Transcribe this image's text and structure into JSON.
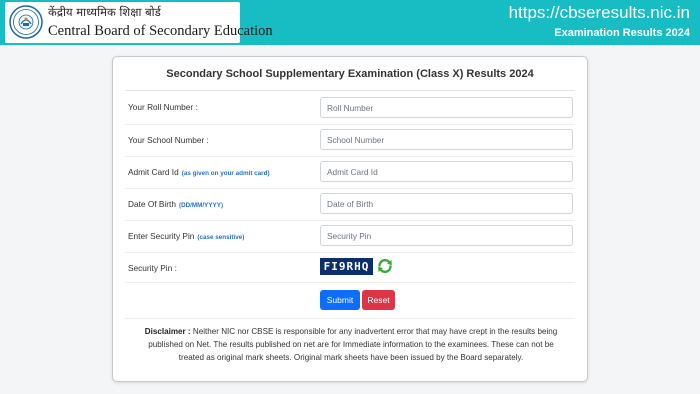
{
  "header": {
    "board_name_hindi": "केंद्रीय माध्यमिक शिक्षा बोर्ड",
    "board_name_english": "Central Board of Secondary Education",
    "site_url": "https://cbseresults.nic.in",
    "site_subtitle": "Examination Results 2024",
    "accent_color": "#18bcc3"
  },
  "form": {
    "title": "Secondary School Supplementary Examination (Class X) Results 2024",
    "roll_number": {
      "label": "Your Roll Number :",
      "placeholder": "Roll Number",
      "value": ""
    },
    "school_number": {
      "label": "Your School Number :",
      "placeholder": "School Number",
      "value": ""
    },
    "admit_card": {
      "label": "Admit Card Id",
      "hint": "(as given on your admit card)",
      "placeholder": "Admit Card Id",
      "value": ""
    },
    "dob": {
      "label": "Date Of Birth",
      "hint": "(DD/MM/YYYY)",
      "placeholder": "Date of Birth",
      "value": ""
    },
    "security_pin_entry": {
      "label": "Enter Security Pin",
      "hint": "(case sensitive)",
      "placeholder": "Security Pin",
      "value": ""
    },
    "security_pin": {
      "label": "Security Pin :",
      "captcha_text": "FI9RHQ",
      "refresh_icon": "refresh-icon"
    },
    "submit_label": "Submit",
    "reset_label": "Reset"
  },
  "disclaimer": {
    "label": "Disclaimer :",
    "text": "Neither NIC nor CBSE is responsible for any inadvertent error that may have crept in the results being published on Net. The results published on net are for Immediate information to the examinees. These can not be treated as original mark sheets. Original mark sheets have been issued by the Board separately."
  }
}
